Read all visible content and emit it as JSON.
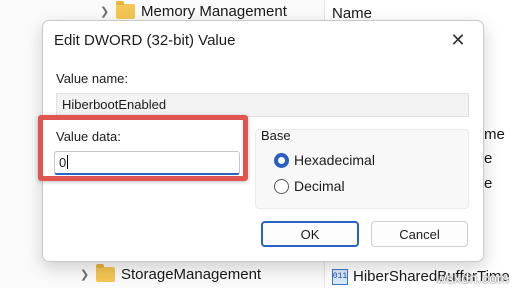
{
  "background": {
    "tree": {
      "top_item": "Memory Management",
      "bottom_item": "StorageManagement"
    },
    "values_pane": {
      "column_header": "Name",
      "peek_suffix_1": "me",
      "peek_suffix_2": "e",
      "peek_suffix_3": "e",
      "bottom_value": "HiberSharedBufferTime",
      "bottom_value_icon_text": "011"
    },
    "watermark": "wsxdn.com"
  },
  "dialog": {
    "title": "Edit DWORD (32-bit) Value",
    "value_name_label": "Value name:",
    "value_name": "HiberbootEnabled",
    "value_data_label": "Value data:",
    "value_data": "0",
    "base": {
      "label": "Base",
      "options": [
        {
          "label": "Hexadecimal",
          "checked": true
        },
        {
          "label": "Decimal",
          "checked": false
        }
      ]
    },
    "ok_label": "OK",
    "cancel_label": "Cancel"
  },
  "colors": {
    "accent": "#2b63c4",
    "highlight_box": "#e0554f",
    "folder": "#f4c653"
  }
}
